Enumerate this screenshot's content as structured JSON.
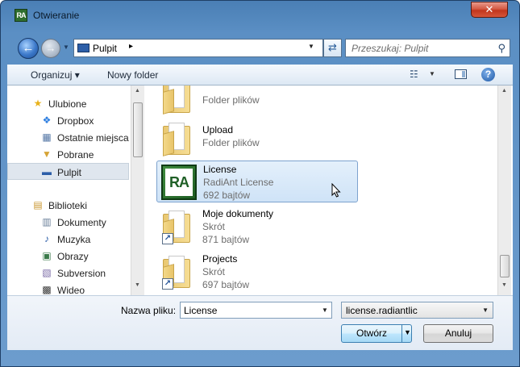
{
  "window": {
    "title": "Otwieranie",
    "app_icon_text": "RA",
    "close_label": "✕"
  },
  "nav": {
    "back_label": "←",
    "forward_label": "→",
    "address": {
      "location": "Pulpit",
      "separator": "▸"
    },
    "search_placeholder": "Przeszukaj: Pulpit"
  },
  "toolbar": {
    "organize_label": "Organizuj ▾",
    "new_folder_label": "Nowy folder",
    "help_label": "?"
  },
  "sidebar": {
    "favorites": [
      {
        "label": "Ulubione",
        "icon": "star-icon"
      },
      {
        "label": "Dropbox",
        "icon": "dropbox-icon"
      },
      {
        "label": "Ostatnie miejsca",
        "icon": "recent-places-icon"
      },
      {
        "label": "Pobrane",
        "icon": "downloads-icon"
      },
      {
        "label": "Pulpit",
        "icon": "desktop-icon",
        "selected": true
      }
    ],
    "libraries": [
      {
        "label": "Biblioteki",
        "icon": "libraries-icon"
      },
      {
        "label": "Dokumenty",
        "icon": "documents-icon"
      },
      {
        "label": "Muzyka",
        "icon": "music-icon"
      },
      {
        "label": "Obrazy",
        "icon": "pictures-icon"
      },
      {
        "label": "Subversion",
        "icon": "subversion-icon"
      },
      {
        "label": "Wideo",
        "icon": "video-icon"
      }
    ]
  },
  "files": [
    {
      "name": "",
      "line2": "Folder plików",
      "kind": "folder"
    },
    {
      "name": "Upload",
      "line2": "Folder plików",
      "kind": "folder"
    },
    {
      "name": "License",
      "line2": "RadiAnt License",
      "line3": "692 bajtów",
      "kind": "license",
      "selected": true,
      "icon_text": "RA"
    },
    {
      "name": "Moje dokumenty",
      "line2": "Skrót",
      "line3": "871 bajtów",
      "kind": "shortcut"
    },
    {
      "name": "Projects",
      "line2": "Skrót",
      "line3": "697 bajtów",
      "kind": "shortcut"
    }
  ],
  "footer": {
    "filename_label": "Nazwa pliku:",
    "filename_value": "License",
    "filetype_value": "license.radiantlic",
    "open_label": "Otwórz",
    "cancel_label": "Anuluj"
  },
  "colors": {
    "accent": "#3c7fb1",
    "selection": "#cfe3f7",
    "frame": "#5b8fc4"
  }
}
